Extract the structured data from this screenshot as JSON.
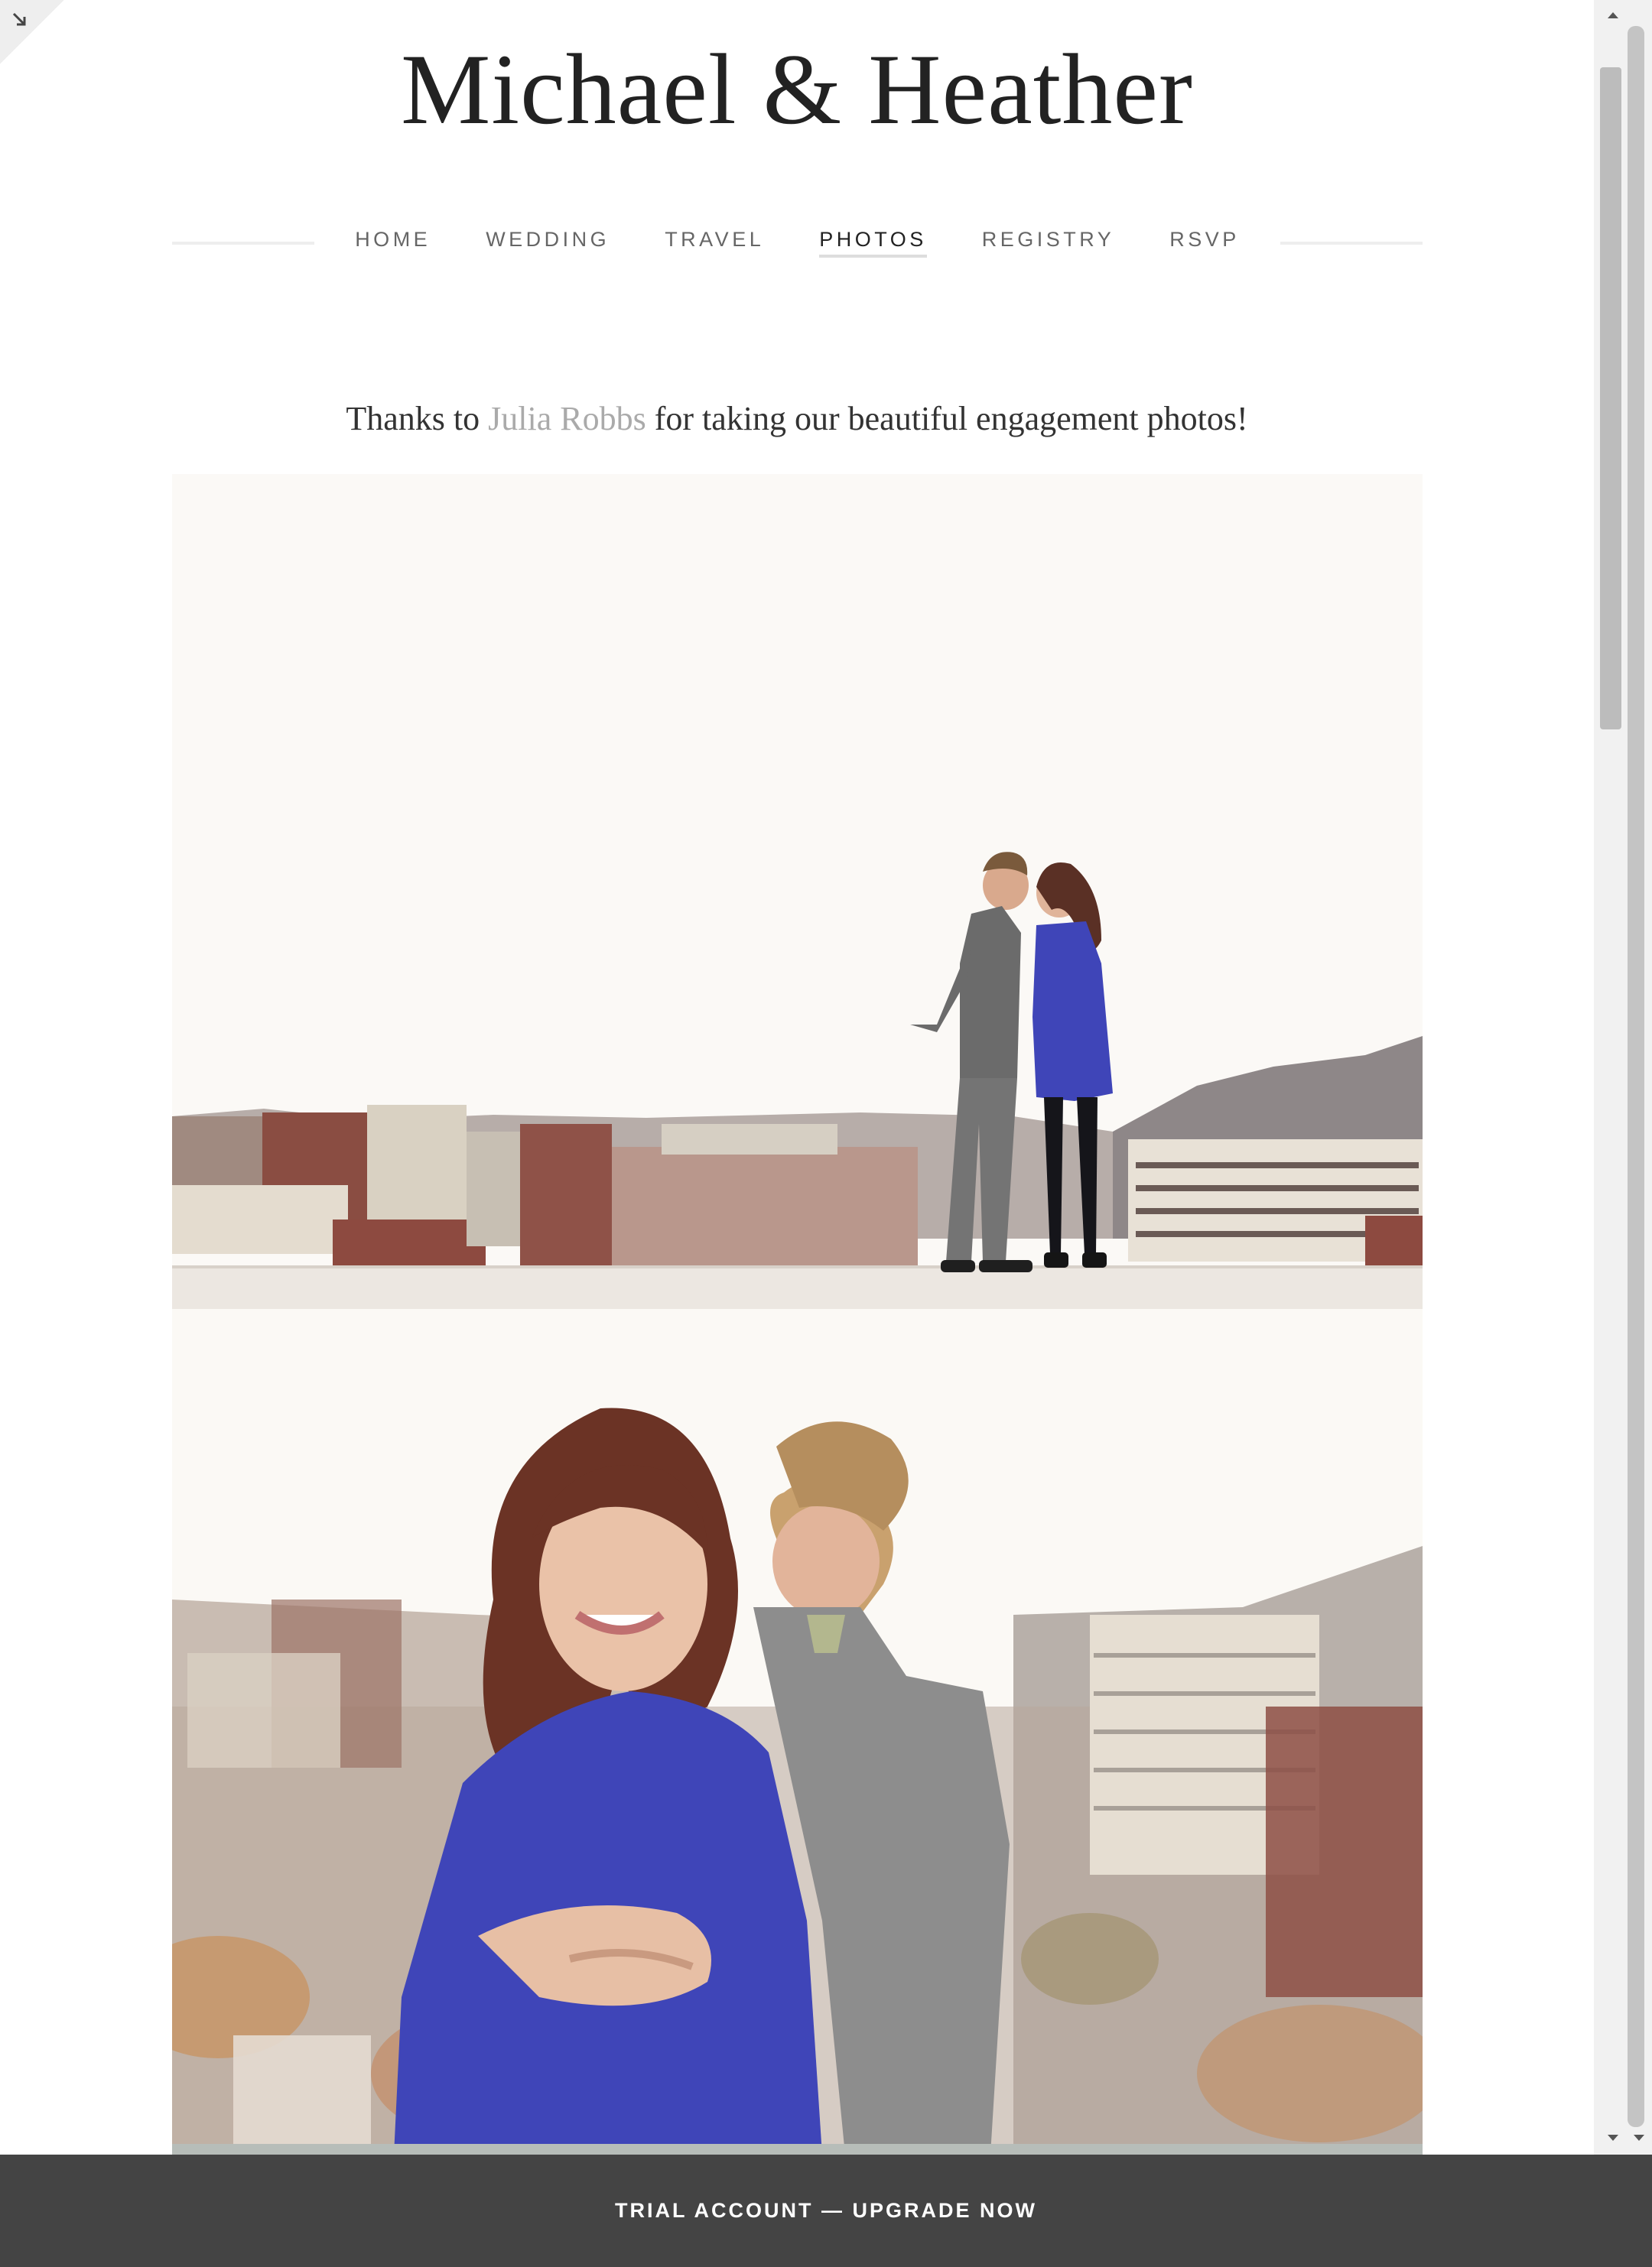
{
  "site": {
    "title": "Michael & Heather"
  },
  "nav": {
    "items": [
      {
        "label": "HOME"
      },
      {
        "label": "WEDDING"
      },
      {
        "label": "TRAVEL"
      },
      {
        "label": "PHOTOS"
      },
      {
        "label": "REGISTRY"
      },
      {
        "label": "RSVP"
      }
    ],
    "active": "PHOTOS"
  },
  "intro": {
    "before": "Thanks to ",
    "link_text": "Julia Robbs",
    "after": " for taking our beautiful engagement photos!"
  },
  "photos": [
    {
      "alt": "Couple kissing on a rooftop above the city skyline"
    },
    {
      "alt": "Couple embracing and smiling with blurred city behind them"
    }
  ],
  "banner": {
    "label": "TRIAL ACCOUNT — UPGRADE NOW"
  },
  "icons": {
    "corner": "resize-arrow-icon",
    "scroll_up": "scroll-up-arrow-icon",
    "scroll_down": "scroll-down-arrow-icon"
  },
  "colors": {
    "banner_bg": "#444444",
    "link": "#aaaaaa",
    "dress_blue": "#3f45b8",
    "text": "#222222"
  }
}
